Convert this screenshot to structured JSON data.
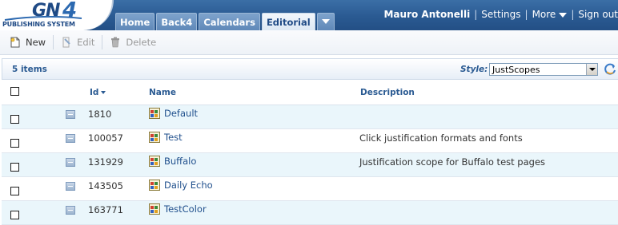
{
  "brand": {
    "logo_main": "GN",
    "logo_number": "4",
    "logo_sub": "PUBLISHING SYSTEM"
  },
  "tabs": [
    {
      "label": "Home",
      "active": false
    },
    {
      "label": "Back4",
      "active": false
    },
    {
      "label": "Calendars",
      "active": false
    },
    {
      "label": "Editorial",
      "active": true
    }
  ],
  "userbar": {
    "user": "Mauro Antonelli",
    "settings": "Settings",
    "more": "More",
    "signout": "Sign out",
    "separator": "|"
  },
  "toolbar": {
    "new_label": "New",
    "edit_label": "Edit",
    "delete_label": "Delete"
  },
  "list": {
    "count_label": "5 items",
    "style_label": "Style:",
    "style_value": "JustScopes"
  },
  "table": {
    "columns": {
      "id": "Id",
      "name": "Name",
      "description": "Description"
    },
    "rows": [
      {
        "id": "1810",
        "name": "Default",
        "description": ""
      },
      {
        "id": "100057",
        "name": "Test",
        "description": "Click justification formats and fonts"
      },
      {
        "id": "131929",
        "name": "Buffalo",
        "description": "Justification scope for Buffalo test pages"
      },
      {
        "id": "143505",
        "name": "Daily Echo",
        "description": ""
      },
      {
        "id": "163771",
        "name": "TestColor",
        "description": ""
      }
    ]
  },
  "colors": {
    "header_blue": "#2a5a92",
    "row_alt": "#eaf6fb",
    "link": "#1f4f8c"
  },
  "icons": {
    "new": "new-document-icon",
    "edit": "edit-icon",
    "delete": "trash-icon",
    "refresh": "refresh-icon",
    "row_type": "document-icon",
    "row_name": "scope-icon"
  }
}
